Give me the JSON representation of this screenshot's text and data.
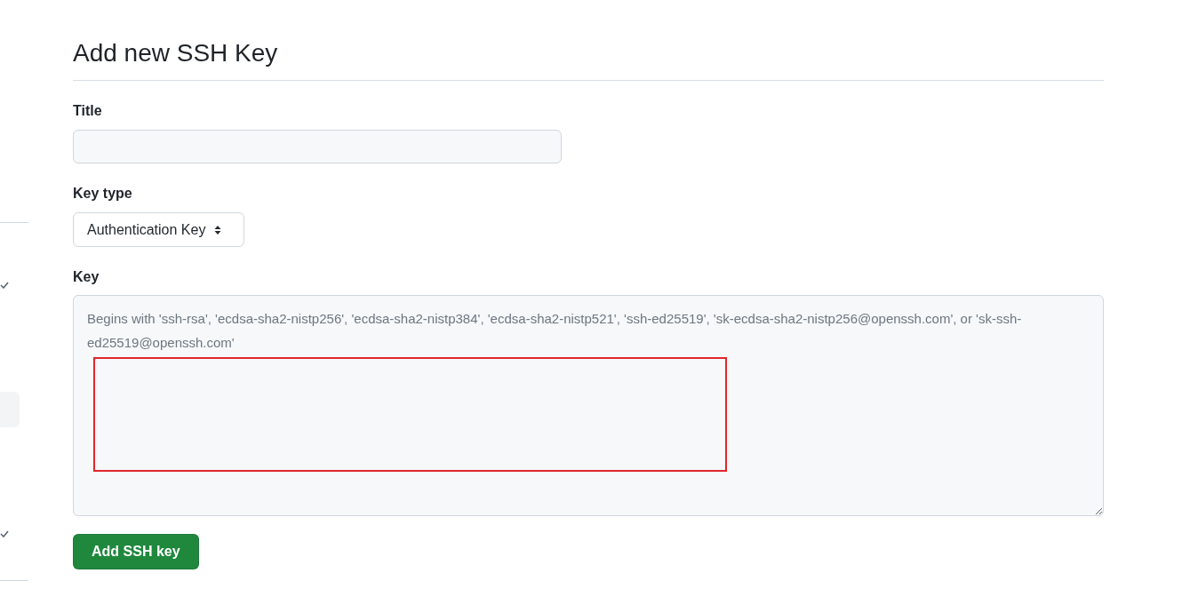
{
  "sidebar": {
    "items": [
      {
        "selected": false,
        "checked": true
      },
      {
        "selected": true,
        "checked": false
      },
      {
        "selected": false,
        "checked": true
      }
    ]
  },
  "heading": "Add new SSH Key",
  "title_field": {
    "label": "Title"
  },
  "key_type": {
    "label": "Key type",
    "value": "Authentication Key"
  },
  "key_field": {
    "label": "Key",
    "placeholder": "Begins with 'ssh-rsa', 'ecdsa-sha2-nistp256', 'ecdsa-sha2-nistp384', 'ecdsa-sha2-nistp521', 'ssh-ed25519', 'sk-ecdsa-sha2-nistp256@openssh.com', or 'sk-ssh-ed25519@openssh.com'"
  },
  "submit_button": "Add SSH key"
}
